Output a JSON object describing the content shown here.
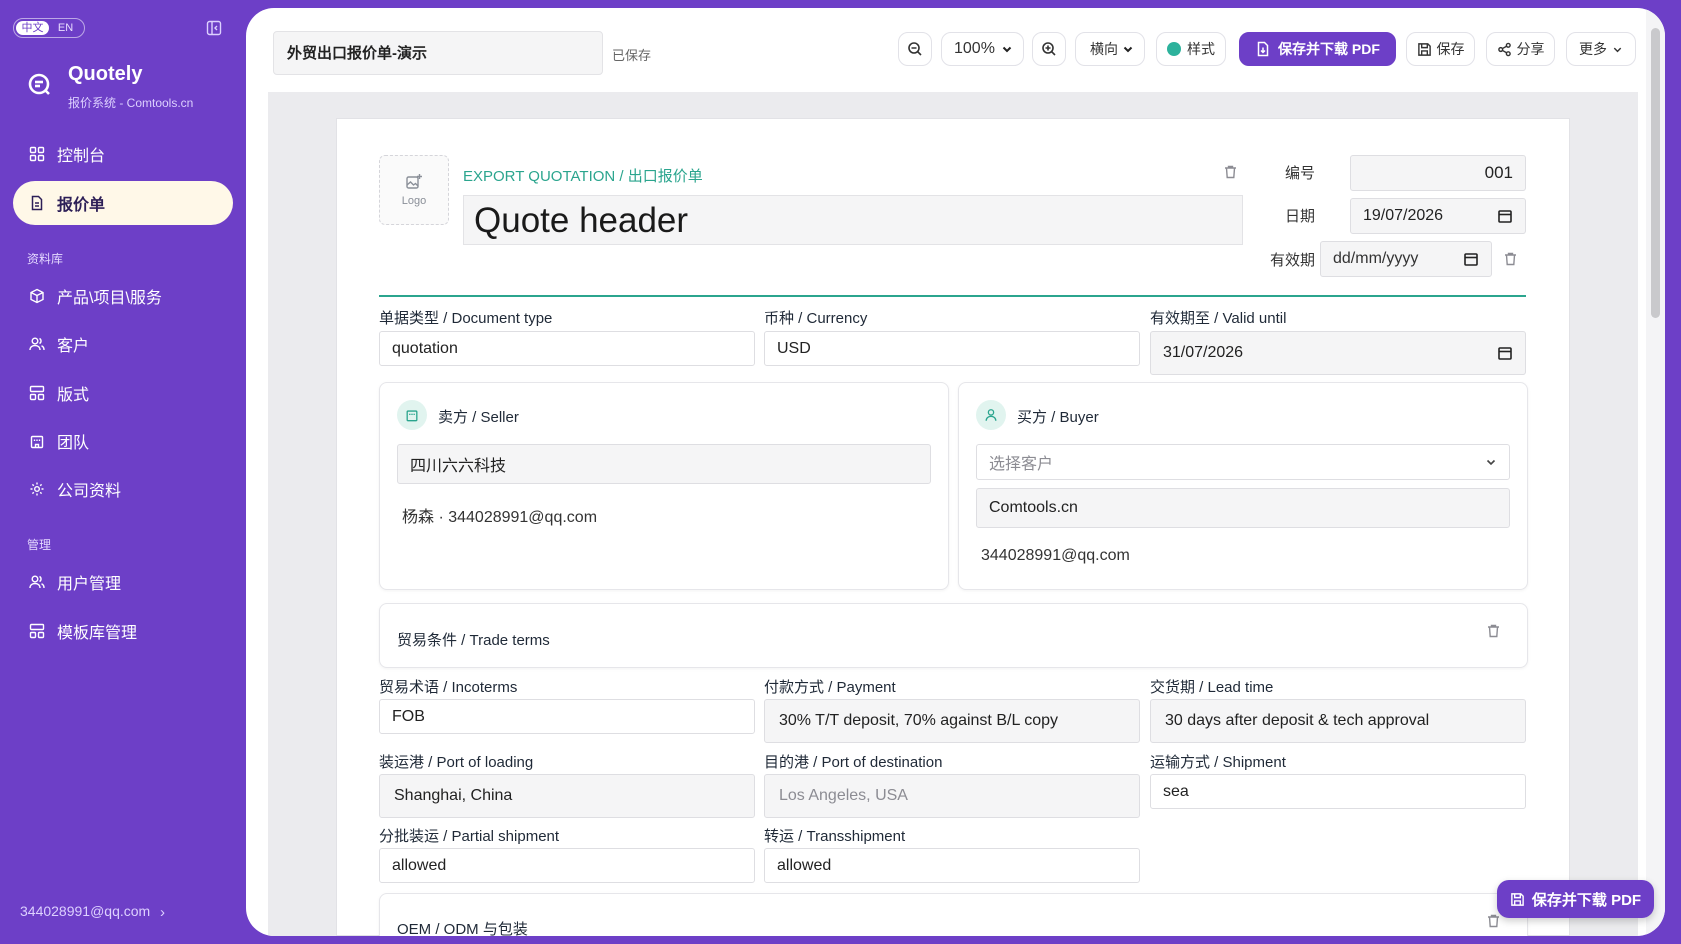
{
  "sidebar": {
    "lang": {
      "zh": "中文",
      "en": "EN"
    },
    "brand": {
      "title": "Quotely",
      "subtitle": "报价系统 - Comtools.cn"
    },
    "items": [
      {
        "label": "控制台",
        "icon": "dashboard-icon"
      },
      {
        "label": "报价单",
        "icon": "document-icon",
        "active": true
      },
      {
        "label": "产品\\项目\\服务",
        "icon": "cube-icon"
      },
      {
        "label": "客户",
        "icon": "users-icon"
      },
      {
        "label": "版式",
        "icon": "layout-icon"
      },
      {
        "label": "团队",
        "icon": "building-icon"
      },
      {
        "label": "公司资料",
        "icon": "gear-icon"
      },
      {
        "label": "用户管理",
        "icon": "users-icon"
      },
      {
        "label": "模板库管理",
        "icon": "layout-icon"
      }
    ],
    "sections": {
      "library": "资料库",
      "admin": "管理"
    },
    "user_email": "344028991@qq.com"
  },
  "toolbar": {
    "doc_title": "外贸出口报价单-演示",
    "saved_status": "已保存",
    "zoom": "100%",
    "orientation": "横向",
    "style_label": "样式",
    "save_pdf_label": "保存并下载 PDF",
    "save_label": "保存",
    "share_label": "分享",
    "more_label": "更多"
  },
  "quote": {
    "logo_label": "Logo",
    "eyebrow": "EXPORT QUOTATION / 出口报价单",
    "header": "Quote header",
    "number_label": "编号",
    "number": "001",
    "date_label": "日期",
    "date": "19/07/2026",
    "validity_label": "有效期",
    "validity_placeholder": "dd/mm/yyyy",
    "doc_type_label": "单据类型 / Document type",
    "doc_type": "quotation",
    "currency_label": "币种 / Currency",
    "currency": "USD",
    "valid_until_label": "有效期至 / Valid until",
    "valid_until": "31/07/2026",
    "seller": {
      "title": "卖方 / Seller",
      "name": "四川六六科技",
      "contact": "杨森 · 344028991@qq.com"
    },
    "buyer": {
      "title": "买方 / Buyer",
      "select_placeholder": "选择客户",
      "name": "Comtools.cn",
      "email": "344028991@qq.com"
    },
    "trade_terms_title": "贸易条件 / Trade terms",
    "fields": {
      "incoterms_label": "贸易术语 / Incoterms",
      "incoterms": "FOB",
      "payment_label": "付款方式 / Payment",
      "payment": "30% T/T deposit, 70% against B/L copy",
      "lead_label": "交货期 / Lead time",
      "lead": "30 days after deposit & tech approval",
      "pol_label": "装运港 / Port of loading",
      "pol": "Shanghai, China",
      "pod_label": "目的港 / Port of destination",
      "pod_placeholder": "Los Angeles, USA",
      "shipment_label": "运输方式 / Shipment",
      "shipment": "sea",
      "partial_label": "分批装运 / Partial shipment",
      "partial": "allowed",
      "trans_label": "转运 / Transshipment",
      "trans": "allowed"
    },
    "oem_title": "OEM / ODM 与包装"
  },
  "fab_label": "保存并下载 PDF",
  "colors": {
    "brand": "#6d3fc7",
    "accent": "#2ba58e",
    "active_nav_bg": "#fff8e8"
  }
}
